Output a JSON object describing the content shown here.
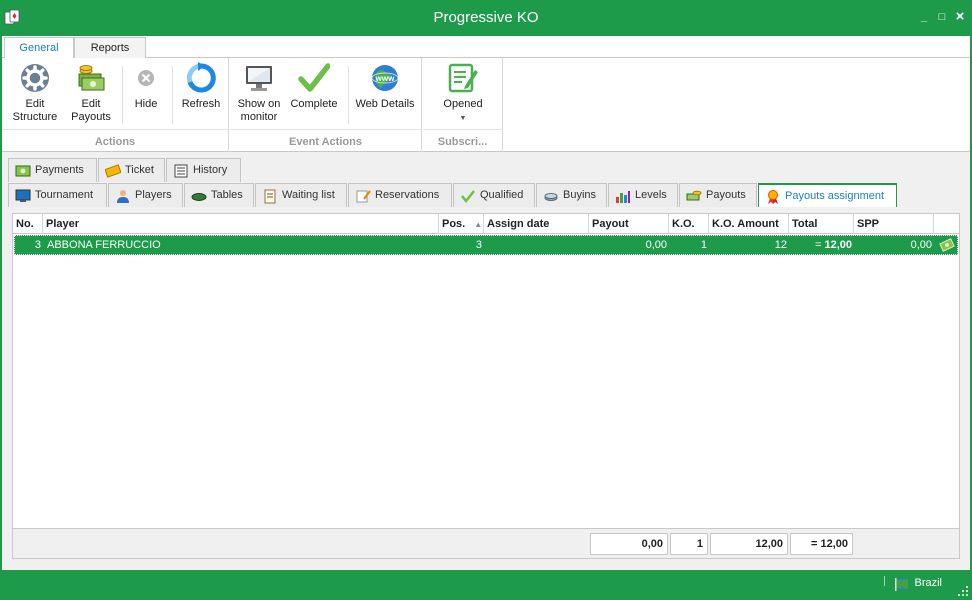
{
  "window": {
    "title": "Progressive KO",
    "minimize": "_",
    "maximize": "□",
    "close": "×"
  },
  "ribbon_tabs": [
    {
      "label": "General",
      "active": true
    },
    {
      "label": "Reports",
      "active": false
    }
  ],
  "ribbon": {
    "groups": {
      "actions": "Actions",
      "event_actions": "Event Actions",
      "subscri": "Subscri..."
    },
    "buttons": {
      "edit_structure": [
        "Edit",
        "Structure"
      ],
      "edit_payouts": [
        "Edit",
        "Payouts"
      ],
      "hide": "Hide",
      "refresh": "Refresh",
      "show_on_monitor": [
        "Show on",
        "monitor"
      ],
      "complete": "Complete",
      "web_details": "Web Details",
      "opened": "Opened"
    }
  },
  "tabs_row1": [
    "Payments",
    "Ticket",
    "History"
  ],
  "tabs_row2": [
    "Tournament",
    "Players",
    "Tables",
    "Waiting list",
    "Reservations",
    "Qualified",
    "Buyins",
    "Levels",
    "Payouts",
    "Payouts assignment"
  ],
  "active_tab": "Payouts assignment",
  "grid": {
    "columns": [
      "No.",
      "Player",
      "Pos.",
      "Assign date",
      "Payout",
      "K.O.",
      "K.O. Amount",
      "Total",
      "SPP"
    ],
    "sort_indicator": "▲",
    "rows": [
      {
        "no": "3",
        "player": "ABBONA FERRUCCIO",
        "pos": "3",
        "assign_date": "",
        "payout": "0,00",
        "ko": "1",
        "ko_amount": "12",
        "total_prefix": "=",
        "total": "12,00",
        "spp": "0,00"
      }
    ],
    "footer": {
      "payout": "0,00",
      "ko": "1",
      "ko_amount": "12,00",
      "total": "= 12,00"
    }
  },
  "status": {
    "country": "Brazil"
  },
  "colors": {
    "accent": "#1d9a4a",
    "tab_active_text": "#1d7fc4"
  }
}
